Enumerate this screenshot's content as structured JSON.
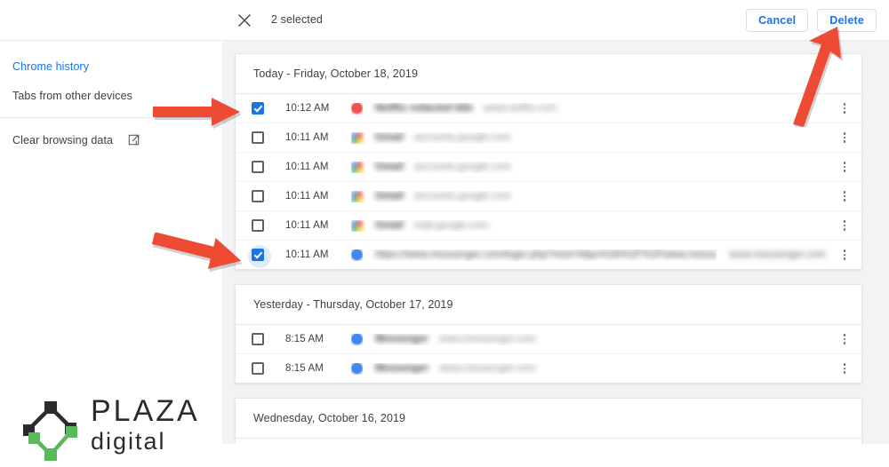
{
  "toolbar": {
    "close_icon": "close-icon",
    "selected_label": "2 selected",
    "cancel_label": "Cancel",
    "delete_label": "Delete",
    "accent_color": "#1a73e8",
    "border_color": "#dadce0"
  },
  "sidebar": {
    "items": [
      {
        "label": "Chrome history",
        "active": true,
        "icon": null
      },
      {
        "label": "Tabs from other devices",
        "active": false,
        "icon": null
      },
      {
        "label": "Clear browsing data",
        "active": false,
        "icon": "external-link-icon"
      }
    ]
  },
  "logo": {
    "name_top": "PLAZA",
    "name_bottom": "digital",
    "color_dark": "#2b2b2b",
    "color_green": "#5cb85c"
  },
  "main": {
    "sections": [
      {
        "header": "Today - Friday, October 18, 2019",
        "rows": [
          {
            "checked": true,
            "focused": false,
            "time": "10:12 AM",
            "favicon": "fav-red",
            "title": "Netflix redacted title",
            "url": "www.netflix.com",
            "domain": ""
          },
          {
            "checked": false,
            "focused": false,
            "time": "10:11 AM",
            "favicon": "fav-google",
            "title": "Gmail",
            "url": "accounts.google.com",
            "domain": ""
          },
          {
            "checked": false,
            "focused": false,
            "time": "10:11 AM",
            "favicon": "fav-google",
            "title": "Gmail",
            "url": "accounts.google.com",
            "domain": ""
          },
          {
            "checked": false,
            "focused": false,
            "time": "10:11 AM",
            "favicon": "fav-google",
            "title": "Gmail",
            "url": "accounts.google.com",
            "domain": ""
          },
          {
            "checked": false,
            "focused": false,
            "time": "10:11 AM",
            "favicon": "fav-google",
            "title": "Gmail",
            "url": "mail.google.com",
            "domain": ""
          },
          {
            "checked": true,
            "focused": true,
            "time": "10:11 AM",
            "favicon": "fav-blue",
            "title": "https://www.messenger.com/login.php?next=https%3A%2F%2Fwww.messenger.com%2F%3Fhc",
            "url": "",
            "domain": "www.messenger.com"
          }
        ]
      },
      {
        "header": "Yesterday - Thursday, October 17, 2019",
        "rows": [
          {
            "checked": false,
            "focused": false,
            "time": "8:15 AM",
            "favicon": "fav-blue",
            "title": "Messenger",
            "url": "www.messenger.com",
            "domain": ""
          },
          {
            "checked": false,
            "focused": false,
            "time": "8:15 AM",
            "favicon": "fav-blue",
            "title": "Messenger",
            "url": "www.messenger.com",
            "domain": ""
          }
        ]
      },
      {
        "header": "Wednesday, October 16, 2019",
        "rows": []
      }
    ]
  },
  "annotations": {
    "color": "#ee4b35",
    "arrows": [
      {
        "name": "arrow-checkbox-row1",
        "points_to": "first-row-checkbox"
      },
      {
        "name": "arrow-checkbox-row6",
        "points_to": "sixth-row-checkbox"
      },
      {
        "name": "arrow-delete-button",
        "points_to": "delete-button"
      }
    ]
  }
}
